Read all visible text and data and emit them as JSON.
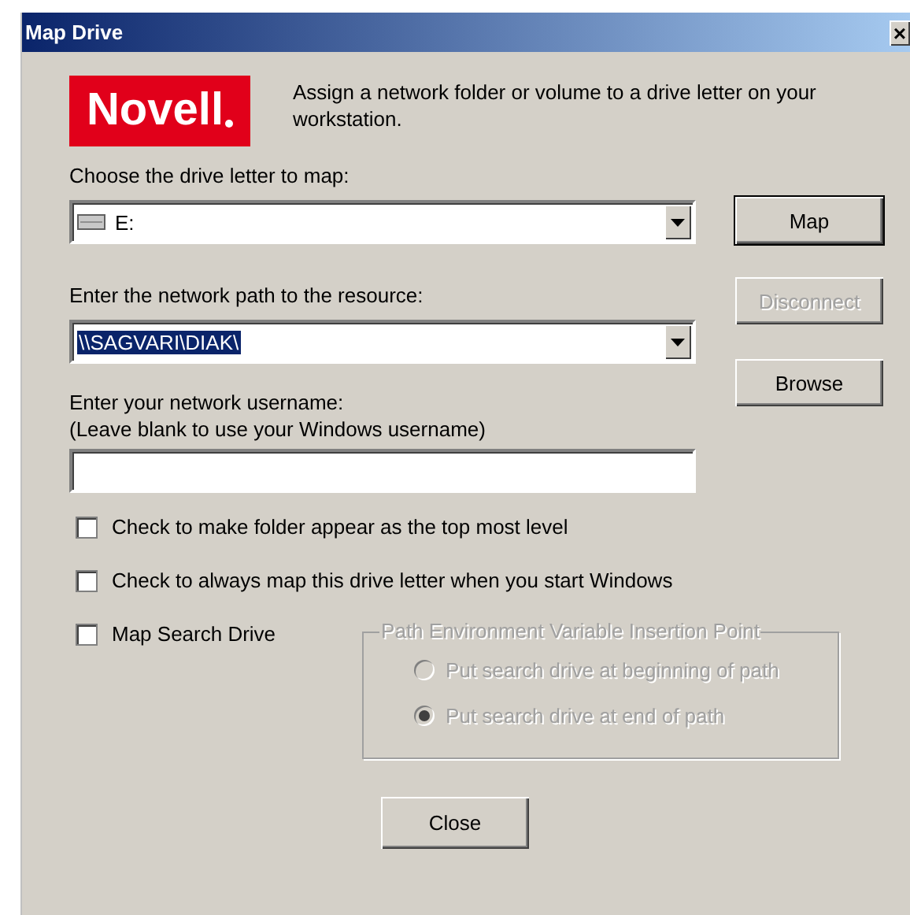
{
  "window": {
    "title": "Map Drive",
    "close": "×"
  },
  "logo": {
    "text": "Novell"
  },
  "description": "Assign a network folder or volume to a drive letter on your workstation.",
  "drive_letter": {
    "label": "Choose the drive letter to map:",
    "value": "E:"
  },
  "network_path": {
    "label": "Enter the network path to the resource:",
    "value": "\\\\SAGVARI\\DIAK\\",
    "selected": true
  },
  "username": {
    "label": "Enter your network username:",
    "note": "(Leave blank to use your Windows username)"
  },
  "side_buttons": [
    {
      "label": "Map",
      "disabled": false,
      "default": true
    },
    {
      "label": "Disconnect",
      "disabled": true,
      "default": false
    },
    {
      "label": "Browse",
      "disabled": false,
      "default": false
    }
  ],
  "checkboxes": [
    {
      "label": "Check to make folder appear as the top most level",
      "checked": false
    },
    {
      "label": "Check to always map this drive letter when you start Windows",
      "checked": false
    },
    {
      "label": "Map Search Drive",
      "checked": false
    }
  ],
  "insertion_point": {
    "title": "Path Environment Variable Insertion Point",
    "disabled": true,
    "options": [
      {
        "label": "Put search drive at beginning of path",
        "selected": false
      },
      {
        "label": "Put search drive at end of path",
        "selected": true
      }
    ]
  },
  "close_button": {
    "label": "Close"
  }
}
